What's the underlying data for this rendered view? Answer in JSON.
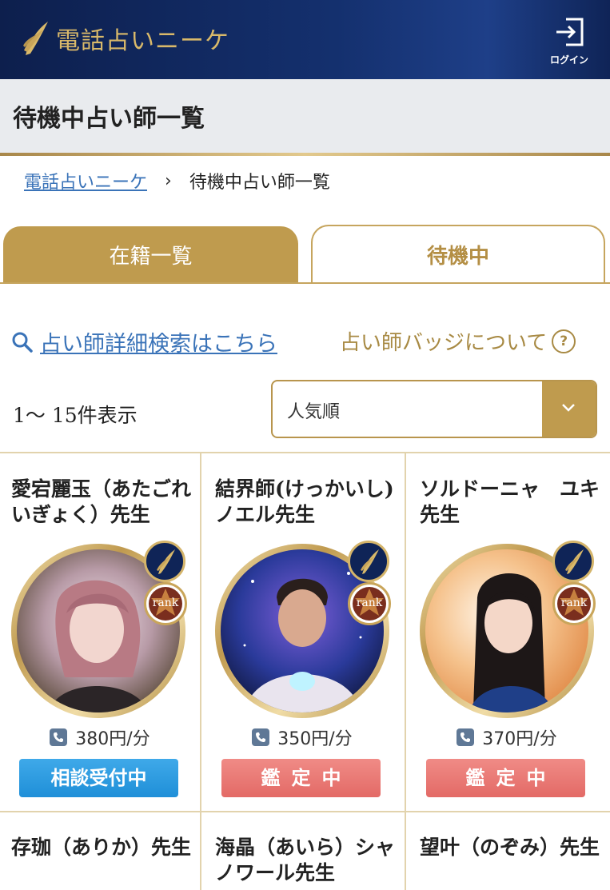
{
  "header": {
    "logo_text": "電話占いニーケ",
    "login_label": "ログイン"
  },
  "page": {
    "title": "待機中占い師一覧"
  },
  "breadcrumb": {
    "home": "電話占いニーケ",
    "separator": "›",
    "current": "待機中占い師一覧"
  },
  "tabs": [
    {
      "label": "在籍一覧",
      "active": false
    },
    {
      "label": "待機中",
      "active": true
    }
  ],
  "search": {
    "link_text": "占い師詳細検索はこちら",
    "badge_text": "占い師バッジについて",
    "help_glyph": "?"
  },
  "listing": {
    "count_text": "1〜 15件表示",
    "sort_value": "人気順"
  },
  "colors": {
    "header_navy": "#0d1f4d",
    "gold": "#bf9b4e",
    "link_blue": "#3a73b8",
    "accepting_blue": "#2a9be0",
    "busy_red": "#e8726e"
  },
  "cards": [
    {
      "name": "愛宕麗玉（あたごれいぎょく）先生",
      "rank_label": "rank",
      "price": "380円/分",
      "status": "相談受付中"
    },
    {
      "name": "結界師(けっかいし)ノエル先生",
      "rank_label": "rank",
      "price": "350円/分",
      "status": "鑑定中"
    },
    {
      "name": "ソルドーニャ　ユキ先生",
      "rank_label": "rank",
      "price": "370円/分",
      "status": "鑑定中"
    }
  ],
  "next_cards": [
    {
      "name": "存珈（ありか）先生"
    },
    {
      "name": "海晶（あいら）シャノワール先生"
    },
    {
      "name": "望叶（のぞみ）先生"
    }
  ]
}
